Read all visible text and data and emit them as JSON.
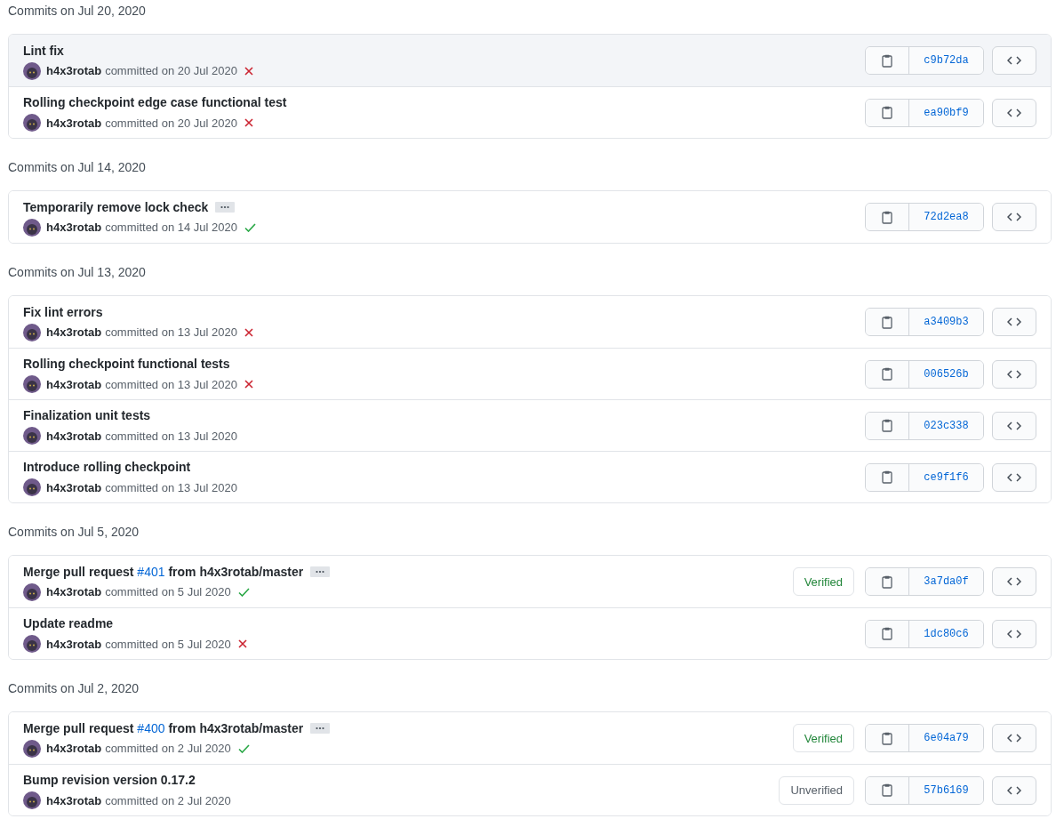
{
  "groups": [
    {
      "heading": "Commits on Jul 20, 2020",
      "commits": [
        {
          "title": "Lint fix",
          "has_more": false,
          "author": "h4x3rotab",
          "date": "committed on 20 Jul 2020",
          "status": {
            "passed": false
          },
          "sha": "c9b72da",
          "highlighted": true
        },
        {
          "title": "Rolling checkpoint edge case functional test",
          "has_more": false,
          "author": "h4x3rotab",
          "date": "committed on 20 Jul 2020",
          "status": {
            "passed": false
          },
          "sha": "ea90bf9",
          "highlighted": false
        }
      ]
    },
    {
      "heading": "Commits on Jul 14, 2020",
      "commits": [
        {
          "title": "Temporarily remove lock check",
          "has_more": true,
          "author": "h4x3rotab",
          "date": "committed on 14 Jul 2020",
          "status": {
            "passed": true
          },
          "sha": "72d2ea8",
          "highlighted": false
        }
      ]
    },
    {
      "heading": "Commits on Jul 13, 2020",
      "commits": [
        {
          "title": "Fix lint errors",
          "has_more": false,
          "author": "h4x3rotab",
          "date": "committed on 13 Jul 2020",
          "status": {
            "passed": false
          },
          "sha": "a3409b3",
          "highlighted": false
        },
        {
          "title": "Rolling checkpoint functional tests",
          "has_more": false,
          "author": "h4x3rotab",
          "date": "committed on 13 Jul 2020",
          "status": {
            "passed": false
          },
          "sha": "006526b",
          "highlighted": false
        },
        {
          "title": "Finalization unit tests",
          "has_more": false,
          "author": "h4x3rotab",
          "date": "committed on 13 Jul 2020",
          "sha": "023c338",
          "highlighted": false
        },
        {
          "title": "Introduce rolling checkpoint",
          "has_more": false,
          "author": "h4x3rotab",
          "date": "committed on 13 Jul 2020",
          "sha": "ce9f1f6",
          "highlighted": false
        }
      ]
    },
    {
      "heading": "Commits on Jul 5, 2020",
      "commits": [
        {
          "title": "Merge pull request",
          "link": "#401",
          "title_rest": "from h4x3rotab/master",
          "has_more": true,
          "author": "h4x3rotab",
          "date": "committed on 5 Jul 2020",
          "status": {
            "passed": true
          },
          "badge": {
            "label": "Verified",
            "verified": true
          },
          "sha": "3a7da0f",
          "highlighted": false
        },
        {
          "title": "Update readme",
          "has_more": false,
          "author": "h4x3rotab",
          "date": "committed on 5 Jul 2020",
          "status": {
            "passed": false
          },
          "sha": "1dc80c6",
          "highlighted": false
        }
      ]
    },
    {
      "heading": "Commits on Jul 2, 2020",
      "commits": [
        {
          "title": "Merge pull request",
          "link": "#400",
          "title_rest": "from h4x3rotab/master",
          "has_more": true,
          "author": "h4x3rotab",
          "date": "committed on 2 Jul 2020",
          "status": {
            "passed": true
          },
          "badge": {
            "label": "Verified",
            "verified": true
          },
          "sha": "6e04a79",
          "highlighted": false
        },
        {
          "title": "Bump revision version 0.17.2",
          "has_more": false,
          "author": "h4x3rotab",
          "date": "committed on 2 Jul 2020",
          "badge": {
            "label": "Unverified",
            "verified": false
          },
          "sha": "57b6169",
          "highlighted": false
        }
      ]
    }
  ]
}
